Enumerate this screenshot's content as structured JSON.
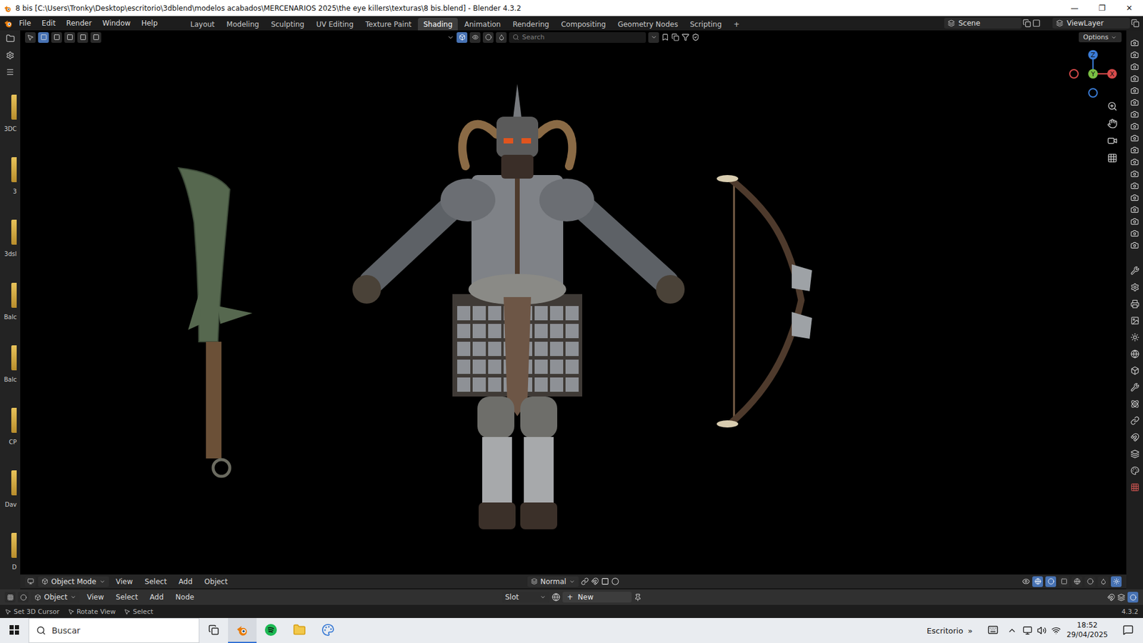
{
  "window": {
    "title": "8 bis [C:\\Users\\Tronky\\Desktop\\escritorio\\3dblend\\modelos acabados\\MERCENARIOS 2025\\the eye killers\\texturas\\8 bis.blend] - Blender 4.3.2",
    "controls": [
      "—",
      "❐",
      "✕"
    ]
  },
  "menu": [
    "File",
    "Edit",
    "Render",
    "Window",
    "Help"
  ],
  "workspaces": [
    {
      "label": "Layout",
      "selected": false
    },
    {
      "label": "Modeling",
      "selected": false
    },
    {
      "label": "Sculpting",
      "selected": false
    },
    {
      "label": "UV Editing",
      "selected": false
    },
    {
      "label": "Texture Paint",
      "selected": false
    },
    {
      "label": "Shading",
      "selected": true
    },
    {
      "label": "Animation",
      "selected": false
    },
    {
      "label": "Rendering",
      "selected": false
    },
    {
      "label": "Compositing",
      "selected": false
    },
    {
      "label": "Geometry Nodes",
      "selected": false
    },
    {
      "label": "Scripting",
      "selected": false
    }
  ],
  "workspace_add": "+",
  "scene": "Scene",
  "view_layer": "ViewLayer",
  "asset_strip": [
    {
      "label": "3DC"
    },
    {
      "label": "3"
    },
    {
      "label": "3dsl"
    },
    {
      "label": "Balc"
    },
    {
      "label": "Balc"
    },
    {
      "label": "CP"
    },
    {
      "label": "Dav"
    },
    {
      "label": "D"
    }
  ],
  "viewport": {
    "search_placeholder": "Search",
    "options": "Options",
    "mode": "Object Mode",
    "menus": [
      "View",
      "Select",
      "Add",
      "Object"
    ],
    "orientation": "Normal",
    "gizmo": [
      {
        "label": "Z",
        "color": "#3b7dd8"
      },
      {
        "label": "Y",
        "color": "#7bc043"
      },
      {
        "label": "X",
        "color": "#d94a4a"
      }
    ]
  },
  "shader_editor": {
    "context": "Object",
    "menus": [
      "View",
      "Select",
      "Add",
      "Node"
    ],
    "slot": "Slot",
    "new_icon": "+",
    "new_button": "New"
  },
  "status_bar": {
    "hints": [
      "Set 3D Cursor",
      "Rotate View",
      "Select"
    ],
    "version": "4.3.2"
  },
  "taskbar": {
    "search": "Buscar",
    "desktop": "Escritorio",
    "more": "»",
    "time": "18:52",
    "date": "29/04/2025"
  }
}
